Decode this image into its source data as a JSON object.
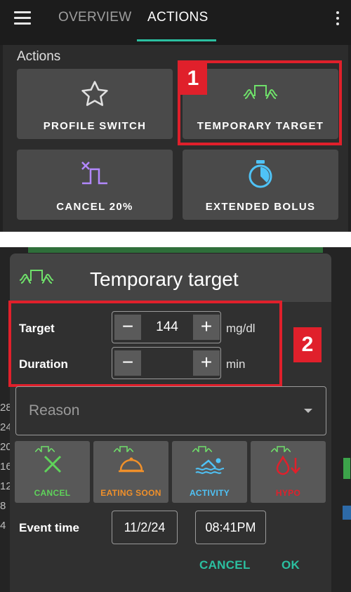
{
  "appbar": {
    "tabs": [
      {
        "label": "OVERVIEW",
        "active": false
      },
      {
        "label": "ACTIONS",
        "active": true
      }
    ],
    "accent": "#2bbfa0"
  },
  "actions": {
    "title": "Actions",
    "tiles": [
      {
        "label": "PROFILE SWITCH",
        "icon": "star-icon"
      },
      {
        "label": "TEMPORARY TARGET",
        "icon": "temp-target-icon"
      },
      {
        "label": "CANCEL 20%",
        "icon": "cancel-tbr-icon"
      },
      {
        "label": "EXTENDED BOLUS",
        "icon": "timer-icon"
      }
    ]
  },
  "annotations": {
    "first": "1",
    "second": "2",
    "color": "#e0202b"
  },
  "background_graph": {
    "numbers": [
      "28",
      "24",
      "20",
      "16",
      "12",
      "8",
      "4"
    ]
  },
  "dialog": {
    "title": "Temporary target",
    "target": {
      "label": "Target",
      "value": "144",
      "unit": "mg/dl",
      "minus": "−",
      "plus": "+"
    },
    "duration": {
      "label": "Duration",
      "value": "",
      "unit": "min",
      "minus": "−",
      "plus": "+"
    },
    "reason": {
      "placeholder": "Reason"
    },
    "presets": [
      {
        "label": "CANCEL",
        "color": "#5fd35a",
        "icon": "cancel-x-icon"
      },
      {
        "label": "EATING SOON",
        "color": "#f0902a",
        "icon": "cloche-icon"
      },
      {
        "label": "ACTIVITY",
        "color": "#4fc3f7",
        "icon": "swimmer-icon"
      },
      {
        "label": "HYPO",
        "color": "#e0202b",
        "icon": "blood-drop-icon"
      }
    ],
    "event_time": {
      "label": "Event time",
      "date": "11/2/24",
      "time": "08:41PM"
    },
    "buttons": {
      "cancel": "CANCEL",
      "ok": "OK"
    }
  }
}
